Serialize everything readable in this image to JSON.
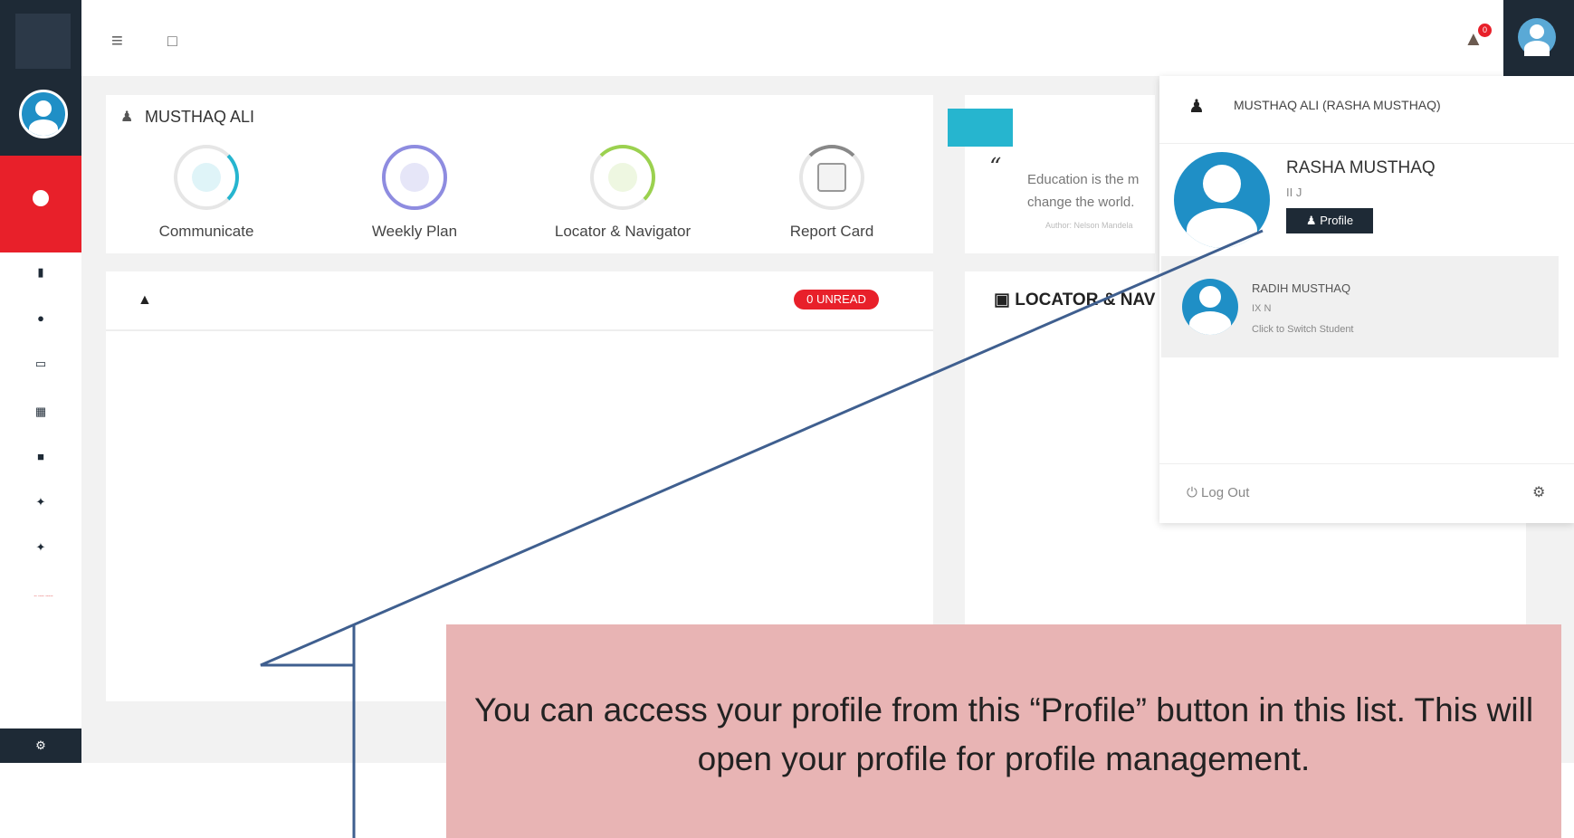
{
  "topbar": {
    "menu_icon": "hamburger-icon",
    "fullscreen_icon": "fullscreen-icon",
    "notification_count": "0"
  },
  "sidebar": {
    "link_text": "-- ---- -----"
  },
  "student_card": {
    "name": "MUSTHAQ ALI",
    "quick_links": [
      {
        "label": "Communicate",
        "icon": "envelope-icon",
        "color": "#26b5cf"
      },
      {
        "label": "Weekly Plan",
        "icon": "calendar-icon",
        "color": "#8e8ce0"
      },
      {
        "label": "Locator & Navigator",
        "icon": "location-pin-icon",
        "color": "#9bd14f"
      },
      {
        "label": "Report Card",
        "icon": "clipboard-icon",
        "color": "#888888"
      }
    ]
  },
  "quote_card": {
    "mark": "“",
    "text": "Education is the m change the world.",
    "author": "Author: Nelson Mandela"
  },
  "notifications_card": {
    "unread_badge": "0 UNREAD"
  },
  "locator_card": {
    "title": "LOCATOR & NAV"
  },
  "profile_dropdown": {
    "header": "MUSTHAQ ALI (RASHA MUSTHAQ)",
    "current_student": {
      "name": "RASHA MUSTHAQ",
      "class": "II J",
      "profile_button": "Profile"
    },
    "other_student": {
      "name": "RADIH MUSTHAQ",
      "class": "IX N",
      "hint": "Click to Switch Student"
    },
    "logout_label": "Log Out"
  },
  "annotation": {
    "text": "You can access your profile from this “Profile” button in this list. This will open your profile for profile management."
  },
  "colors": {
    "sidebar_dark": "#1e2a36",
    "accent_red": "#e8202a",
    "accent_cyan": "#26b5cf",
    "avatar_blue": "#1f8fc6",
    "callout_pink": "#e8b4b4",
    "pointer_line": "#3f5f8f"
  }
}
